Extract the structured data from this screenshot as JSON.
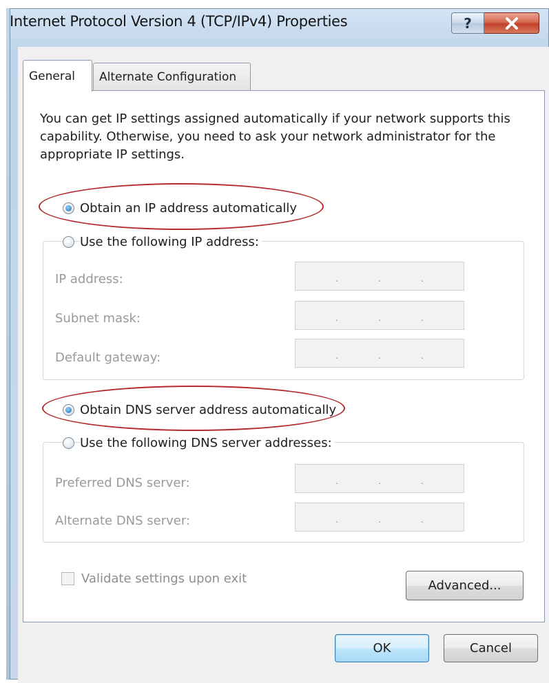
{
  "window": {
    "title": "Internet Protocol Version 4 (TCP/IPv4) Properties",
    "help_label": "?",
    "close_label": "✕"
  },
  "tabs": [
    {
      "label": "General",
      "selected": true
    },
    {
      "label": "Alternate Configuration",
      "selected": false
    }
  ],
  "intro_text": "You can get IP settings assigned automatically if your network supports this capability. Otherwise, you need to ask your network administrator for the appropriate IP settings.",
  "ip_section": {
    "auto_label": "Obtain an IP address automatically",
    "auto_checked": true,
    "manual_label": "Use the following IP address:",
    "fields": [
      {
        "label": "IP address:",
        "value": ""
      },
      {
        "label": "Subnet mask:",
        "value": ""
      },
      {
        "label": "Default gateway:",
        "value": ""
      }
    ]
  },
  "dns_section": {
    "auto_label": "Obtain DNS server address automatically",
    "auto_checked": true,
    "manual_label": "Use the following DNS server addresses:",
    "fields": [
      {
        "label": "Preferred DNS server:",
        "value": ""
      },
      {
        "label": "Alternate DNS server:",
        "value": ""
      }
    ]
  },
  "validate_label": "Validate settings upon exit",
  "validate_checked": false,
  "buttons": {
    "advanced": "Advanced...",
    "ok": "OK",
    "cancel": "Cancel"
  },
  "ip_separator": ".",
  "highlight_color": "#b52a2e"
}
